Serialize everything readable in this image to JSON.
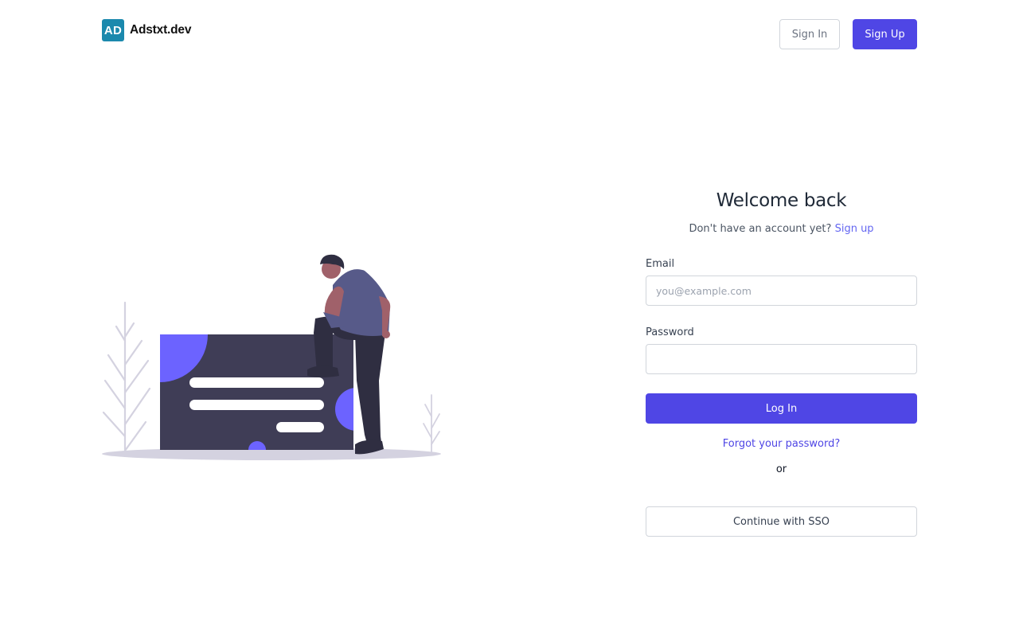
{
  "header": {
    "logo_mark": "AD",
    "logo_text": "Adstxt.dev",
    "signin_label": "Sign In",
    "signup_label": "Sign Up"
  },
  "illustration": {
    "icon": "person-thinking-with-card-illustration"
  },
  "form": {
    "title": "Welcome back",
    "subtitle_text": "Don't have an account yet?",
    "subtitle_link": "Sign up",
    "email_label": "Email",
    "email_placeholder": "you@example.com",
    "email_value": "",
    "password_label": "Password",
    "password_value": "",
    "login_label": "Log In",
    "forgot_label": "Forgot your password?",
    "or_label": "or",
    "sso_label": "Continue with SSO"
  },
  "colors": {
    "primary": "#4f46e5",
    "logo_bg": "#1b89ad",
    "illustration_card": "#3f3d56",
    "illustration_accent": "#6c63ff"
  }
}
